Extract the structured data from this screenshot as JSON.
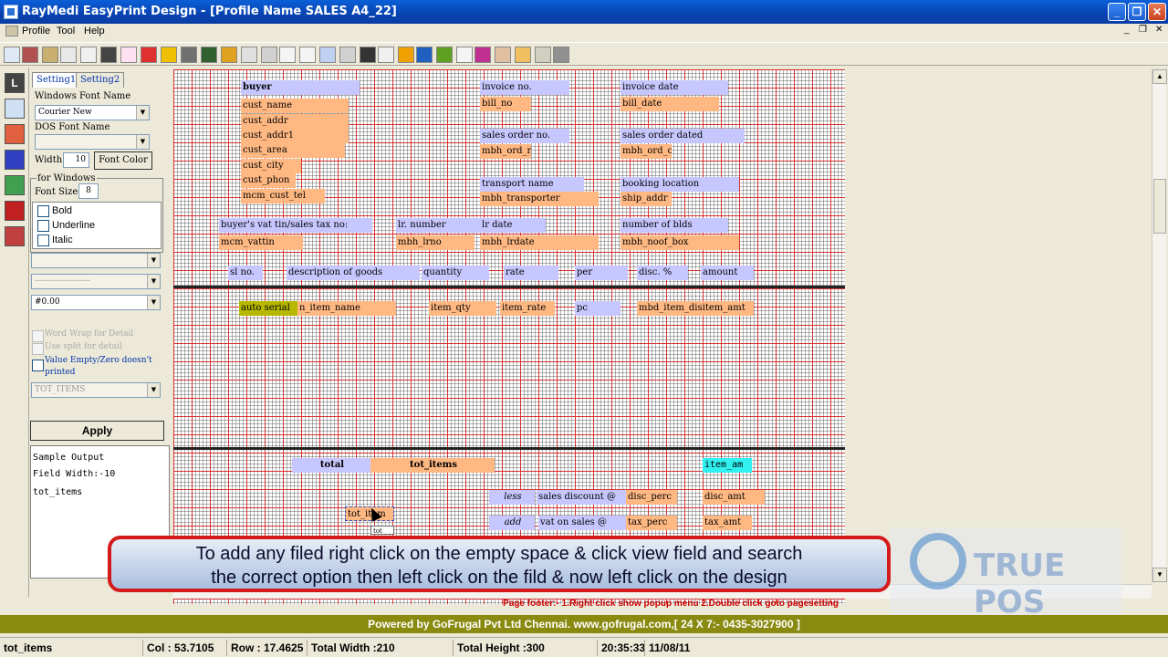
{
  "window": {
    "title": "RayMedi EasyPrint Design - [Profile Name SALES A4_22]"
  },
  "window_controls": {
    "minimize": "_",
    "maximize": "❐",
    "close": "✕"
  },
  "menubar": {
    "items": [
      "Profile",
      "Tool",
      "Help"
    ]
  },
  "panel": {
    "tabs": [
      "Setting1",
      "Setting2"
    ],
    "windows_font_name_label": "Windows Font Name",
    "windows_font_name_value": "Courier New",
    "dos_font_name_label": "DOS Font Name",
    "dos_font_name_value": "",
    "width_label": "Width",
    "width_value": "10",
    "font_color_button": "Font Color",
    "for_windows_label": "for Windows",
    "font_size_label": "Font Size",
    "font_size_value": "8",
    "bold_label": "Bold",
    "underline_label": "Underline",
    "italic_label": "Italic",
    "dashes_value": "--------------------",
    "format_value": "#0.00",
    "word_wrap_label": "Word Wrap for Detail",
    "use_split_label": "Use split for detail",
    "value_empty_label": "Value Empty/Zero doesn't printed",
    "field_value": "TOT_ITEMS",
    "apply_button": "Apply",
    "sample_lines": [
      "Sample Output",
      "Field Width:-10",
      "tot_items"
    ]
  },
  "design": {
    "header_fields": {
      "buyer": "buyer",
      "cust_name": "cust_name",
      "cust_addr": "cust_addr",
      "cust_addr1": "cust_addr1",
      "cust_area": "cust_area",
      "cust_city": "cust_city",
      "cust_phon": "cust_phon",
      "mcm_cust_tel": "mcm_cust_tel",
      "invoice_no": "invoice no.",
      "bill_no": "bill_no",
      "invoice_date": "invoice date",
      "bill_date": "bill_date",
      "sales_order_no": "sales order no.",
      "mbh_ord_no": "mbh_ord_r",
      "sales_order_dated": "sales order dated",
      "mbh_ord_dated": "mbh_ord_c",
      "transport_name": "transport name",
      "mbh_transporter": "mbh_transporter",
      "booking_location": "booking location",
      "ship_addr": "ship_addr",
      "vat_tin_label": "buyer's vat tin/sales tax no:",
      "mcm_vattin": "mcm_vattin",
      "lr_number": "lr. number",
      "mbh_lrno": "mbh_lrno",
      "lr_date": "lr date",
      "mbh_lrdate": "mbh_lrdate",
      "number_of_blds": "number of blds",
      "mbh_noof_box": "mbh_noof_box"
    },
    "column_headers": [
      "sl no.",
      "description of goods",
      "quantity",
      "rate",
      "per",
      "disc. %",
      "amount"
    ],
    "detail_fields": {
      "auto_serial": "auto serial",
      "item_name": "n_item_name",
      "item_qty": "item_qty",
      "item_rate": "item_rate",
      "pc": "pc",
      "item_amt": "mbd_item_disitem_amt"
    },
    "footer_fields": {
      "total": "total",
      "tot_items": "tot_items",
      "item_am": "item_am",
      "less": "less",
      "sales_discount": "sales discount @",
      "disc_perc": "disc_perc",
      "disc_amt": "disc_amt",
      "add": "add",
      "vat_on_sales": "vat on sales @",
      "tax_perc": "tax_perc",
      "tax_amt": "tax_amt",
      "selected": "tot_item",
      "selected_tooltip": "tot_"
    }
  },
  "caption": {
    "line1": "To add any filed right click on the empty space & click view field and search",
    "line2": "the correct option then left click on the fild & now left click on the design"
  },
  "watermark": {
    "text": "TRUE POS"
  },
  "page_footer": "Page footer:- 1.Right click show popup menu 2.Double click goto pagesetting",
  "powered_by": "Powered by GoFrugal Pvt Ltd Chennai. www.gofrugal.com,[ 24 X 7:- 0435-3027900 ]",
  "status": {
    "field": "tot_items",
    "col": "Col : 53.7105",
    "row": "Row : 17.4625",
    "total_width": "Total Width :210",
    "total_height": "Total Height :300",
    "time": "20:35:33",
    "date": "11/08/11"
  },
  "colors": {
    "title_bar": "#0A5FD8",
    "field_label": "#c7c7ff",
    "field_value": "#ffb882",
    "grid_major": "#dc1e1e",
    "powered_bar": "#8a8a10",
    "caption_border": "#d41a1a"
  }
}
